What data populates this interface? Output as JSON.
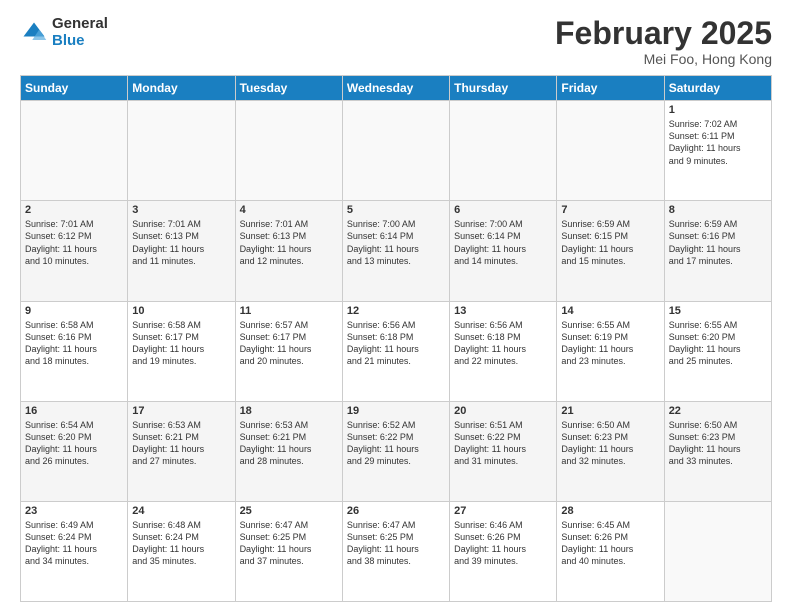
{
  "header": {
    "logo_general": "General",
    "logo_blue": "Blue",
    "title": "February 2025",
    "location": "Mei Foo, Hong Kong"
  },
  "days_of_week": [
    "Sunday",
    "Monday",
    "Tuesday",
    "Wednesday",
    "Thursday",
    "Friday",
    "Saturday"
  ],
  "weeks": [
    [
      {
        "day": "",
        "info": ""
      },
      {
        "day": "",
        "info": ""
      },
      {
        "day": "",
        "info": ""
      },
      {
        "day": "",
        "info": ""
      },
      {
        "day": "",
        "info": ""
      },
      {
        "day": "",
        "info": ""
      },
      {
        "day": "1",
        "info": "Sunrise: 7:02 AM\nSunset: 6:11 PM\nDaylight: 11 hours\nand 9 minutes."
      }
    ],
    [
      {
        "day": "2",
        "info": "Sunrise: 7:01 AM\nSunset: 6:12 PM\nDaylight: 11 hours\nand 10 minutes."
      },
      {
        "day": "3",
        "info": "Sunrise: 7:01 AM\nSunset: 6:13 PM\nDaylight: 11 hours\nand 11 minutes."
      },
      {
        "day": "4",
        "info": "Sunrise: 7:01 AM\nSunset: 6:13 PM\nDaylight: 11 hours\nand 12 minutes."
      },
      {
        "day": "5",
        "info": "Sunrise: 7:00 AM\nSunset: 6:14 PM\nDaylight: 11 hours\nand 13 minutes."
      },
      {
        "day": "6",
        "info": "Sunrise: 7:00 AM\nSunset: 6:14 PM\nDaylight: 11 hours\nand 14 minutes."
      },
      {
        "day": "7",
        "info": "Sunrise: 6:59 AM\nSunset: 6:15 PM\nDaylight: 11 hours\nand 15 minutes."
      },
      {
        "day": "8",
        "info": "Sunrise: 6:59 AM\nSunset: 6:16 PM\nDaylight: 11 hours\nand 17 minutes."
      }
    ],
    [
      {
        "day": "9",
        "info": "Sunrise: 6:58 AM\nSunset: 6:16 PM\nDaylight: 11 hours\nand 18 minutes."
      },
      {
        "day": "10",
        "info": "Sunrise: 6:58 AM\nSunset: 6:17 PM\nDaylight: 11 hours\nand 19 minutes."
      },
      {
        "day": "11",
        "info": "Sunrise: 6:57 AM\nSunset: 6:17 PM\nDaylight: 11 hours\nand 20 minutes."
      },
      {
        "day": "12",
        "info": "Sunrise: 6:56 AM\nSunset: 6:18 PM\nDaylight: 11 hours\nand 21 minutes."
      },
      {
        "day": "13",
        "info": "Sunrise: 6:56 AM\nSunset: 6:18 PM\nDaylight: 11 hours\nand 22 minutes."
      },
      {
        "day": "14",
        "info": "Sunrise: 6:55 AM\nSunset: 6:19 PM\nDaylight: 11 hours\nand 23 minutes."
      },
      {
        "day": "15",
        "info": "Sunrise: 6:55 AM\nSunset: 6:20 PM\nDaylight: 11 hours\nand 25 minutes."
      }
    ],
    [
      {
        "day": "16",
        "info": "Sunrise: 6:54 AM\nSunset: 6:20 PM\nDaylight: 11 hours\nand 26 minutes."
      },
      {
        "day": "17",
        "info": "Sunrise: 6:53 AM\nSunset: 6:21 PM\nDaylight: 11 hours\nand 27 minutes."
      },
      {
        "day": "18",
        "info": "Sunrise: 6:53 AM\nSunset: 6:21 PM\nDaylight: 11 hours\nand 28 minutes."
      },
      {
        "day": "19",
        "info": "Sunrise: 6:52 AM\nSunset: 6:22 PM\nDaylight: 11 hours\nand 29 minutes."
      },
      {
        "day": "20",
        "info": "Sunrise: 6:51 AM\nSunset: 6:22 PM\nDaylight: 11 hours\nand 31 minutes."
      },
      {
        "day": "21",
        "info": "Sunrise: 6:50 AM\nSunset: 6:23 PM\nDaylight: 11 hours\nand 32 minutes."
      },
      {
        "day": "22",
        "info": "Sunrise: 6:50 AM\nSunset: 6:23 PM\nDaylight: 11 hours\nand 33 minutes."
      }
    ],
    [
      {
        "day": "23",
        "info": "Sunrise: 6:49 AM\nSunset: 6:24 PM\nDaylight: 11 hours\nand 34 minutes."
      },
      {
        "day": "24",
        "info": "Sunrise: 6:48 AM\nSunset: 6:24 PM\nDaylight: 11 hours\nand 35 minutes."
      },
      {
        "day": "25",
        "info": "Sunrise: 6:47 AM\nSunset: 6:25 PM\nDaylight: 11 hours\nand 37 minutes."
      },
      {
        "day": "26",
        "info": "Sunrise: 6:47 AM\nSunset: 6:25 PM\nDaylight: 11 hours\nand 38 minutes."
      },
      {
        "day": "27",
        "info": "Sunrise: 6:46 AM\nSunset: 6:26 PM\nDaylight: 11 hours\nand 39 minutes."
      },
      {
        "day": "28",
        "info": "Sunrise: 6:45 AM\nSunset: 6:26 PM\nDaylight: 11 hours\nand 40 minutes."
      },
      {
        "day": "",
        "info": ""
      }
    ]
  ]
}
